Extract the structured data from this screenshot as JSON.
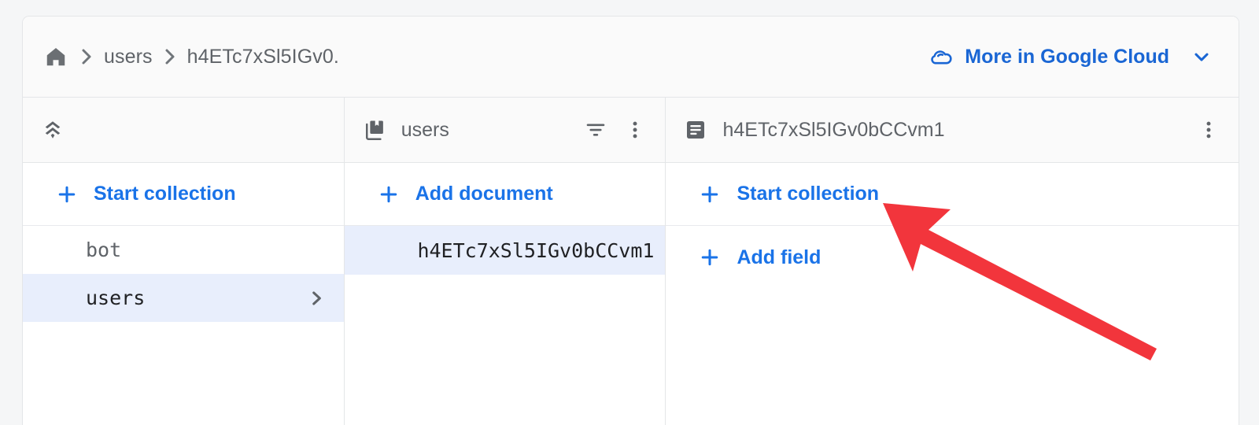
{
  "header": {
    "breadcrumb": {
      "home_icon": "home-icon",
      "separator": "›",
      "items": [
        {
          "label": "users"
        },
        {
          "label": "h4ETc7xSl5IGv0."
        }
      ]
    },
    "more_in_cloud": {
      "icon": "cloud-icon",
      "label": "More in Google Cloud",
      "chevron": "chevron-down-icon"
    }
  },
  "columns": {
    "database": {
      "header": {
        "icon": "firestore-database-icon",
        "title": ""
      },
      "action": {
        "icon": "plus-icon",
        "label": "Start collection"
      },
      "items": [
        {
          "label": "bot",
          "selected": false,
          "has_chevron": false
        },
        {
          "label": "users",
          "selected": true,
          "has_chevron": true
        }
      ]
    },
    "collection": {
      "header": {
        "icon": "collection-icon",
        "title": "users",
        "filter_icon": "filter-icon",
        "menu_icon": "more-vert-icon"
      },
      "action": {
        "icon": "plus-icon",
        "label": "Add document"
      },
      "items": [
        {
          "label": "h4ETc7xSl5IGv0bCCvm1",
          "selected": true
        }
      ]
    },
    "document": {
      "header": {
        "icon": "document-icon",
        "title": "h4ETc7xSl5IGv0bCCvm1",
        "menu_icon": "more-vert-icon"
      },
      "actions": [
        {
          "icon": "plus-icon",
          "label": "Start collection"
        },
        {
          "icon": "plus-icon",
          "label": "Add field"
        }
      ]
    }
  },
  "annotation": {
    "arrow": {
      "name": "red-arrow-annotation",
      "color": "#f2353c",
      "points_to": "Start collection"
    }
  },
  "colors": {
    "accent_blue": "#1a73e8",
    "link_blue": "#1a66d4",
    "selected_row": "#e8eefc",
    "header_bg": "#fafafa",
    "border": "#e4e6e8",
    "text_secondary": "#5f6368",
    "annotation_red": "#f2353c"
  }
}
